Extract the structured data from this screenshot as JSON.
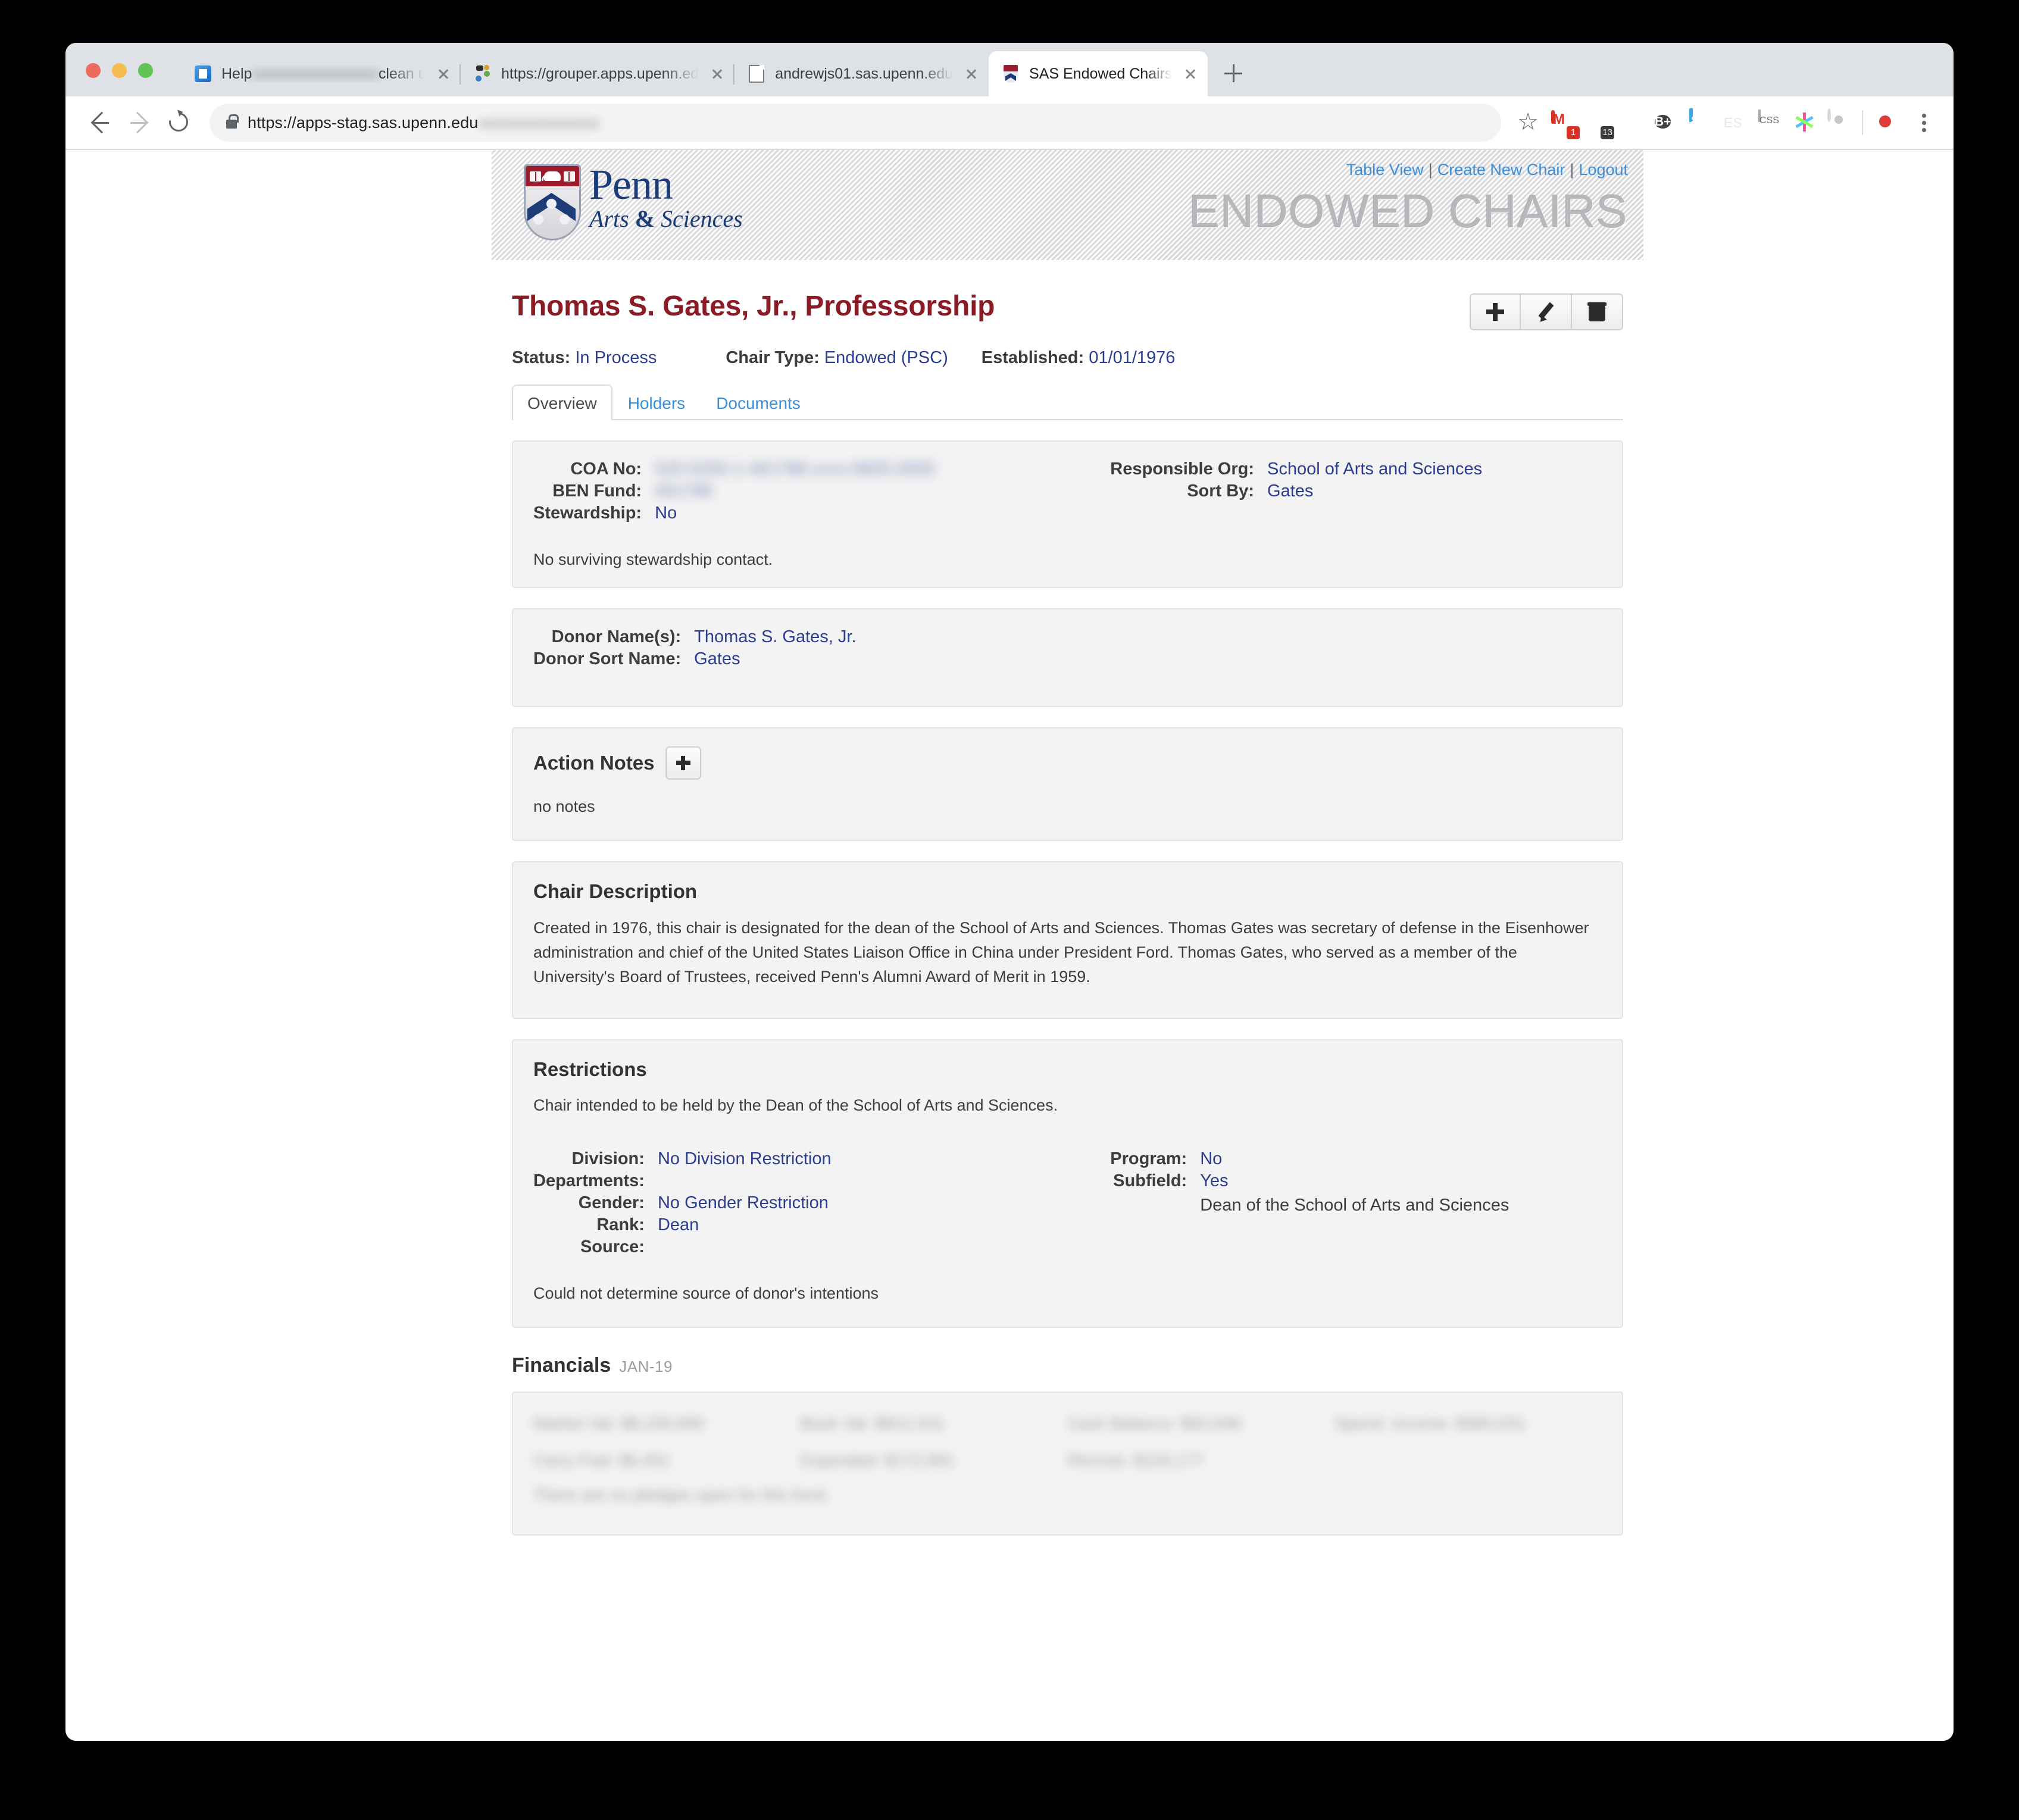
{
  "browser": {
    "tabs": [
      {
        "title_prefix": "Help",
        "title_redacted": "xxxxxxxxxxxxxxxxx",
        "title_suffix": "clean u",
        "favicon": "blue-doc-icon",
        "active": false
      },
      {
        "title_prefix": "https://grouper.apps.upenn.ed",
        "title_redacted": "",
        "title_suffix": "",
        "favicon": "grouper-icon",
        "active": false
      },
      {
        "title_prefix": "andrewjs01.sas.upenn.edu",
        "title_redacted": "",
        "title_suffix": "",
        "favicon": "page-icon",
        "active": false
      },
      {
        "title_prefix": "SAS Endowed Chairs",
        "title_redacted": "",
        "title_suffix": "",
        "favicon": "penn-shield-icon",
        "active": true
      }
    ],
    "new_tab_label": "+",
    "url_visible": "https://apps-stag.sas.upenn.edu",
    "url_redacted": "xxxxxxxxxxxxxxx",
    "extensions": [
      {
        "name": "gmail-extension-icon",
        "badge": "1"
      },
      {
        "name": "mail-extension-icon",
        "badge": "13"
      },
      {
        "name": "shield-extension-icon",
        "badge": ""
      },
      {
        "name": "bplus-extension-icon",
        "badge": ""
      },
      {
        "name": "six-extension-icon",
        "badge": ""
      },
      {
        "name": "es-extension-icon",
        "badge": ""
      },
      {
        "name": "css-extension-icon",
        "badge": ""
      },
      {
        "name": "star-extension-icon",
        "badge": ""
      },
      {
        "name": "ring-extension-icon",
        "badge": ""
      }
    ]
  },
  "banner": {
    "links": {
      "table_view": "Table View",
      "create_new_chair": "Create New Chair",
      "logout": "Logout",
      "separator": "|"
    },
    "title": "ENDOWED CHAIRS",
    "logo": {
      "penn": "Penn",
      "arts": "Arts",
      "amp": "&",
      "sciences": "Sciences"
    }
  },
  "page": {
    "title": "Thomas S. Gates, Jr., Professorship",
    "actions": [
      {
        "name": "add-button",
        "icon": "plus-icon"
      },
      {
        "name": "edit-button",
        "icon": "pencil-icon"
      },
      {
        "name": "delete-button",
        "icon": "trash-icon"
      }
    ],
    "meta": [
      {
        "label": "Status:",
        "value": "In Process"
      },
      {
        "label": "Chair Type:",
        "value": "Endowed (PSC)"
      },
      {
        "label": "Established:",
        "value": "01/01/1976"
      }
    ],
    "tabs": [
      {
        "label": "Overview",
        "active": true
      },
      {
        "label": "Holders",
        "active": false
      },
      {
        "label": "Documents",
        "active": false
      }
    ]
  },
  "overview": {
    "left": [
      {
        "label": "COA No:",
        "value": "520-5200-1-461788-xxxx-6605-0000",
        "redacted": true
      },
      {
        "label": "BEN Fund:",
        "value": "461788",
        "redacted": true
      },
      {
        "label": "Stewardship:",
        "value": "No",
        "redacted": false
      }
    ],
    "right": [
      {
        "label": "Responsible Org:",
        "value": "School of Arts and Sciences",
        "redacted": false
      },
      {
        "label": "Sort By:",
        "value": "Gates",
        "redacted": false
      }
    ],
    "note": "No surviving stewardship contact."
  },
  "donor": {
    "rows": [
      {
        "label": "Donor Name(s):",
        "value": "Thomas S. Gates, Jr."
      },
      {
        "label": "Donor Sort Name:",
        "value": "Gates"
      }
    ]
  },
  "action_notes": {
    "heading": "Action Notes",
    "add_label": "+",
    "empty_text": "no notes"
  },
  "chair_description": {
    "heading": "Chair Description",
    "body": "Created in 1976, this chair is designated for the dean of the School of Arts and Sciences. Thomas Gates was secretary of defense in the Eisenhower administration and chief of the United States Liaison Office in China under President Ford. Thomas Gates, who served as a member of the University's Board of Trustees, received Penn's Alumni Award of Merit in 1959."
  },
  "restrictions": {
    "heading": "Restrictions",
    "summary": "Chair intended to be held by the Dean of the School of Arts and Sciences.",
    "left": [
      {
        "label": "Division:",
        "value": "No Division Restriction",
        "plain": false
      },
      {
        "label": "Departments:",
        "value": "",
        "plain": false
      },
      {
        "label": "Gender:",
        "value": "No Gender Restriction",
        "plain": false
      },
      {
        "label": "Rank:",
        "value": "Dean",
        "plain": false
      },
      {
        "label": "Source:",
        "value": "",
        "plain": false
      }
    ],
    "right": [
      {
        "label": "Program:",
        "value": "No",
        "plain": false
      },
      {
        "label": "Subfield:",
        "value": "Yes",
        "plain": false
      },
      {
        "label": "",
        "value": "",
        "plain": true
      },
      {
        "label": "",
        "value": "Dean of the School of Arts and Sciences",
        "plain": true
      }
    ],
    "footnote": "Could not determine source of donor's intentions"
  },
  "financials": {
    "heading": "Financials",
    "period": "JAN-19",
    "cells": [
      "Market Val: $8,230,000",
      "Book Val: $812,431",
      "Cash Balance: $92,046",
      "Spend. Income: $365,031",
      "Carry Fwd: $6,451",
      "Expended: $172,991",
      "Rtrcrsts: $103,177",
      ""
    ],
    "note": "There are no pledges open for this fund."
  }
}
